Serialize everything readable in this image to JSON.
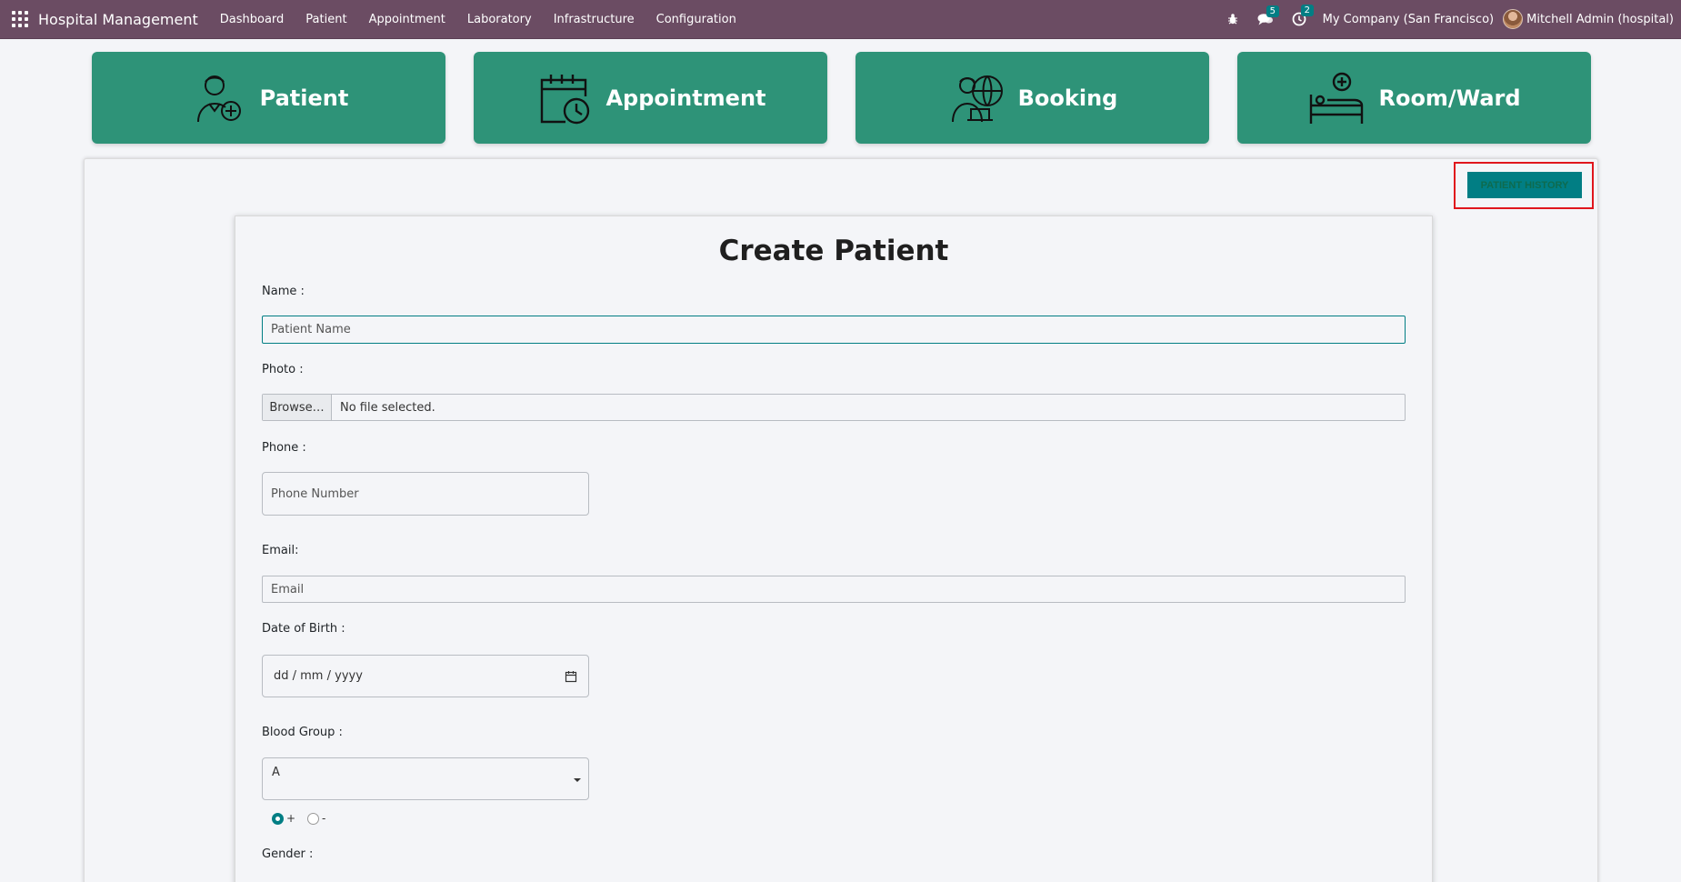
{
  "navbar": {
    "brand": "Hospital Management",
    "menu": [
      "Dashboard",
      "Patient",
      "Appointment",
      "Laboratory",
      "Infrastructure",
      "Configuration"
    ],
    "messages_count": "5",
    "activities_count": "2",
    "company": "My Company (San Francisco)",
    "user": "Mitchell Admin (hospital)"
  },
  "tiles": [
    {
      "label": "Patient",
      "icon": "patient-add-icon"
    },
    {
      "label": "Appointment",
      "icon": "calendar-clock-icon"
    },
    {
      "label": "Booking",
      "icon": "doctor-globe-icon"
    },
    {
      "label": "Room/Ward",
      "icon": "hospital-bed-icon"
    }
  ],
  "panel": {
    "history_button": "PATIENT HISTORY"
  },
  "form": {
    "title": "Create Patient",
    "name_label": "Name :",
    "name_placeholder": "Patient Name",
    "photo_label": "Photo :",
    "browse_label": "Browse…",
    "file_status": "No file selected.",
    "phone_label": "Phone :",
    "phone_placeholder": "Phone Number",
    "email_label": "Email:",
    "email_placeholder": "Email",
    "dob_label": "Date of Birth :",
    "dob_placeholder": "dd / mm / yyyy",
    "blood_group_label": "Blood Group :",
    "blood_group_value": "A",
    "rh_options": [
      "+",
      "-"
    ],
    "rh_selected": "+",
    "gender_label": "Gender :"
  },
  "colors": {
    "navbar": "#6b4c63",
    "tile": "#2e9378",
    "accent": "#017e84",
    "highlight": "#e0161d"
  }
}
